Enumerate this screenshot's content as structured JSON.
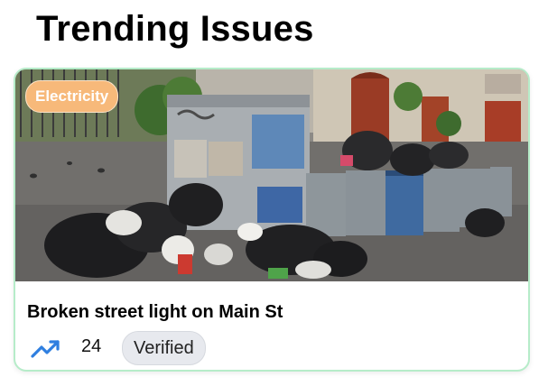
{
  "section": {
    "title": "Trending Issues"
  },
  "issue": {
    "category": "Electricity",
    "title": "Broken street light on Main St",
    "votes": "24",
    "status": "Verified",
    "image_alt": "Street with overflowing garbage bins and trash bags",
    "trend_icon": "trending-up-icon"
  },
  "colors": {
    "badge_bg": "#f7b97a",
    "card_border": "#b6ecc9",
    "trend_icon": "#2f7fe0",
    "chip_bg": "#e7e9ee"
  }
}
